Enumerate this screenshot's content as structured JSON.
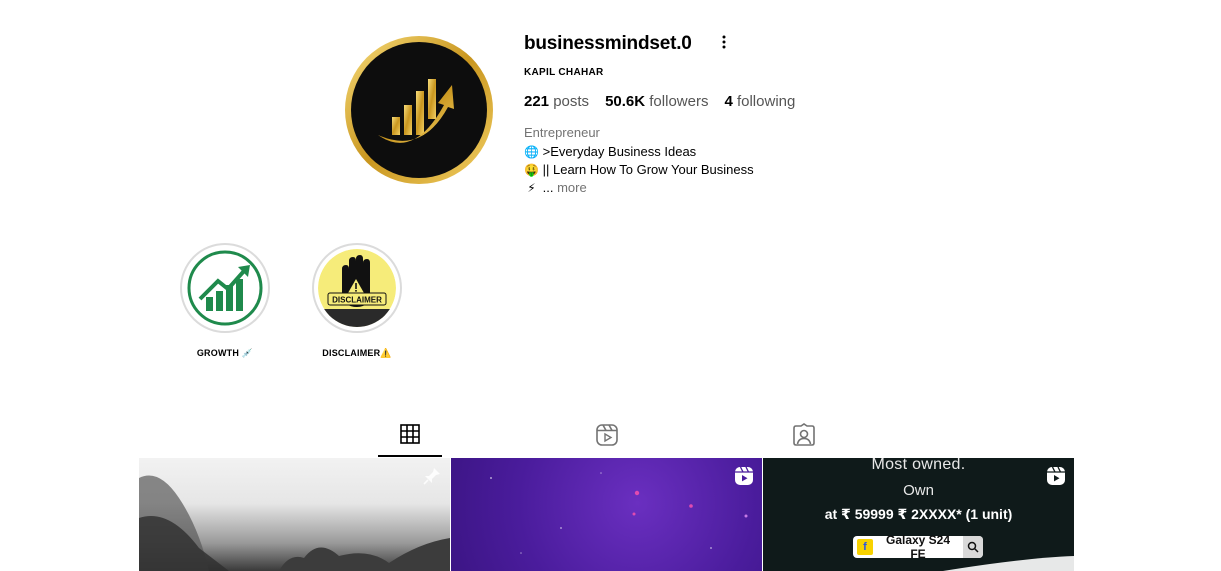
{
  "profile": {
    "username": "businessmindset.0",
    "full_name": "KAPIL CHAHAR",
    "stats": {
      "posts_count": "221",
      "posts_label": "posts",
      "followers_count": "50.6K",
      "followers_label": "followers",
      "following_count": "4",
      "following_label": "following"
    },
    "category": "Entrepreneur",
    "bio": {
      "line1_emoji": "🌐",
      "line1": ">Everyday Business Ideas",
      "line2_emoji": "🤑",
      "line2": "|| Learn How To Grow Your Business",
      "line3_emoji": "⚡",
      "line3": "...",
      "more_label": "more"
    }
  },
  "highlights": [
    {
      "label": "GROWTH 💉",
      "icon": "growth-chart-icon"
    },
    {
      "label": "DISCLAIMER⚠️",
      "icon": "disclaimer-hand-icon",
      "cover_text": "DISCLAIMER"
    }
  ],
  "tabs": [
    {
      "name": "posts",
      "icon": "grid-icon",
      "active": true
    },
    {
      "name": "reels",
      "icon": "reels-icon",
      "active": false
    },
    {
      "name": "tagged",
      "icon": "tagged-icon",
      "active": false
    }
  ],
  "posts": [
    {
      "type": "pinned",
      "icon": "pin-icon"
    },
    {
      "type": "reel",
      "icon": "reels-icon"
    },
    {
      "type": "reel",
      "icon": "reels-icon",
      "text_line1": "Most owned.",
      "text_line2": "Own",
      "text_line3": "at ₹ 59999 ₹ 2XXXX* (1 unit)",
      "badge_text": "Galaxy S24 FE"
    }
  ],
  "colors": {
    "gold": "#d4a52a",
    "growth_green": "#1f8a4c",
    "disclaimer_yellow": "#f6ec7a",
    "muted_text": "#737373",
    "reel_purple": "#4a1c9c"
  }
}
